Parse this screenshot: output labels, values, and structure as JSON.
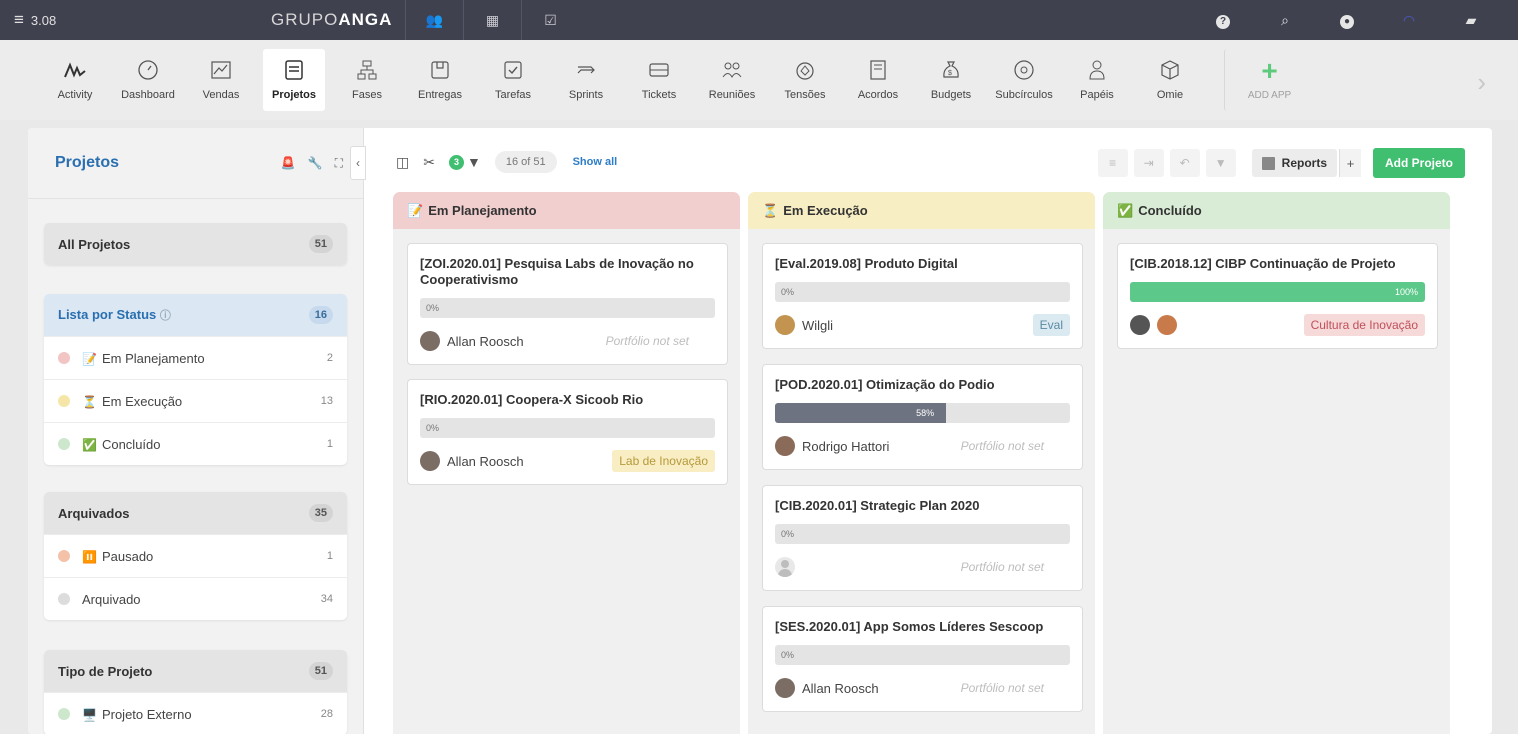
{
  "topbar": {
    "menu_label": "3.08",
    "brand_light": "GRUPO",
    "brand_bold": "ANGA"
  },
  "apps": [
    {
      "label": "Activity",
      "icon": "activity-icon"
    },
    {
      "label": "Dashboard",
      "icon": "gauge-icon"
    },
    {
      "label": "Vendas",
      "icon": "chart-icon"
    },
    {
      "label": "Projetos",
      "icon": "folder-icon",
      "active": true
    },
    {
      "label": "Fases",
      "icon": "hierarchy-icon"
    },
    {
      "label": "Entregas",
      "icon": "package-icon"
    },
    {
      "label": "Tarefas",
      "icon": "checkbox-icon"
    },
    {
      "label": "Sprints",
      "icon": "sprint-icon"
    },
    {
      "label": "Tickets",
      "icon": "ticket-icon"
    },
    {
      "label": "Reuniões",
      "icon": "people-icon"
    },
    {
      "label": "Tensões",
      "icon": "tension-icon"
    },
    {
      "label": "Acordos",
      "icon": "document-icon"
    },
    {
      "label": "Budgets",
      "icon": "money-bag-icon"
    },
    {
      "label": "Subcírculos",
      "icon": "circle-icon"
    },
    {
      "label": "Papéis",
      "icon": "role-icon"
    },
    {
      "label": "Omie",
      "icon": "cube-icon"
    }
  ],
  "add_app_label": "ADD APP",
  "sidebar": {
    "title": "Projetos",
    "all": {
      "label": "All Projetos",
      "count": "51"
    },
    "status": {
      "label": "Lista por Status",
      "count": "16",
      "items": [
        {
          "label": "Em Planejamento",
          "emoji": "📝",
          "count": "2",
          "dot": "#f2c4c4"
        },
        {
          "label": "Em Execução",
          "emoji": "⏳",
          "count": "13",
          "dot": "#f5e6a8"
        },
        {
          "label": "Concluído",
          "emoji": "✅",
          "count": "1",
          "dot": "#cde7cd"
        }
      ]
    },
    "archived": {
      "label": "Arquivados",
      "count": "35",
      "items": [
        {
          "label": "Pausado",
          "emoji": "⏸️",
          "count": "1",
          "dot": "#f3c2a8"
        },
        {
          "label": "Arquivado",
          "emoji": "",
          "count": "34",
          "dot": "#dcdcdc"
        }
      ]
    },
    "type": {
      "label": "Tipo de Projeto",
      "count": "51",
      "items": [
        {
          "label": "Projeto Externo",
          "emoji": "🖥️",
          "count": "28",
          "dot": "#cde7cd"
        }
      ]
    }
  },
  "toolbar": {
    "filter_count": "3",
    "count_label": "16 of 51",
    "show_all": "Show all",
    "reports": "Reports",
    "plus": "+",
    "add": "Add Projeto"
  },
  "columns": [
    {
      "title": "Em Planejamento",
      "emoji": "📝",
      "color": "#f2cfcf",
      "cards": [
        {
          "title": "[ZOI.2020.01] Pesquisa Labs de Inovação no Cooperativismo",
          "progress": 0,
          "progress_label": "0%",
          "owner": "Allan Roosch",
          "portfolio": "Portfólio not set"
        },
        {
          "title": "[RIO.2020.01] Coopera-X Sicoob Rio",
          "progress": 0,
          "progress_label": "0%",
          "owner": "Allan Roosch",
          "tag": "Lab de Inovação"
        }
      ]
    },
    {
      "title": "Em Execução",
      "emoji": "⏳",
      "color": "#f7eec4",
      "cards": [
        {
          "title": "[Eval.2019.08] Produto Digital",
          "progress": 0,
          "progress_label": "0%",
          "owner": "Wilgli",
          "tag": "Eval"
        },
        {
          "title": "[POD.2020.01] Otimização do Podio",
          "progress": 58,
          "progress_label": "58%",
          "owner": "Rodrigo Hattori",
          "portfolio": "Portfólio not set"
        },
        {
          "title": "[CIB.2020.01] Strategic Plan 2020",
          "progress": 0,
          "progress_label": "0%",
          "owner": "",
          "portfolio": "Portfólio not set"
        },
        {
          "title": "[SES.2020.01] App Somos Líderes Sescoop",
          "progress": 0,
          "progress_label": "0%",
          "owner": "Allan Roosch",
          "portfolio": "Portfólio not set"
        }
      ]
    },
    {
      "title": "Concluído",
      "emoji": "✅",
      "color": "#d9ecd5",
      "cards": [
        {
          "title": "[CIB.2018.12] CIBP Continuação de Projeto",
          "progress": 100,
          "progress_label": "100%",
          "owner": "",
          "tag": "Cultura de Inovação"
        }
      ]
    }
  ],
  "colors": {
    "accent_green": "#3fbf6f",
    "link_blue": "#2d7cc8",
    "progress_dark": "#6e7381",
    "progress_done": "#5cc88a"
  }
}
